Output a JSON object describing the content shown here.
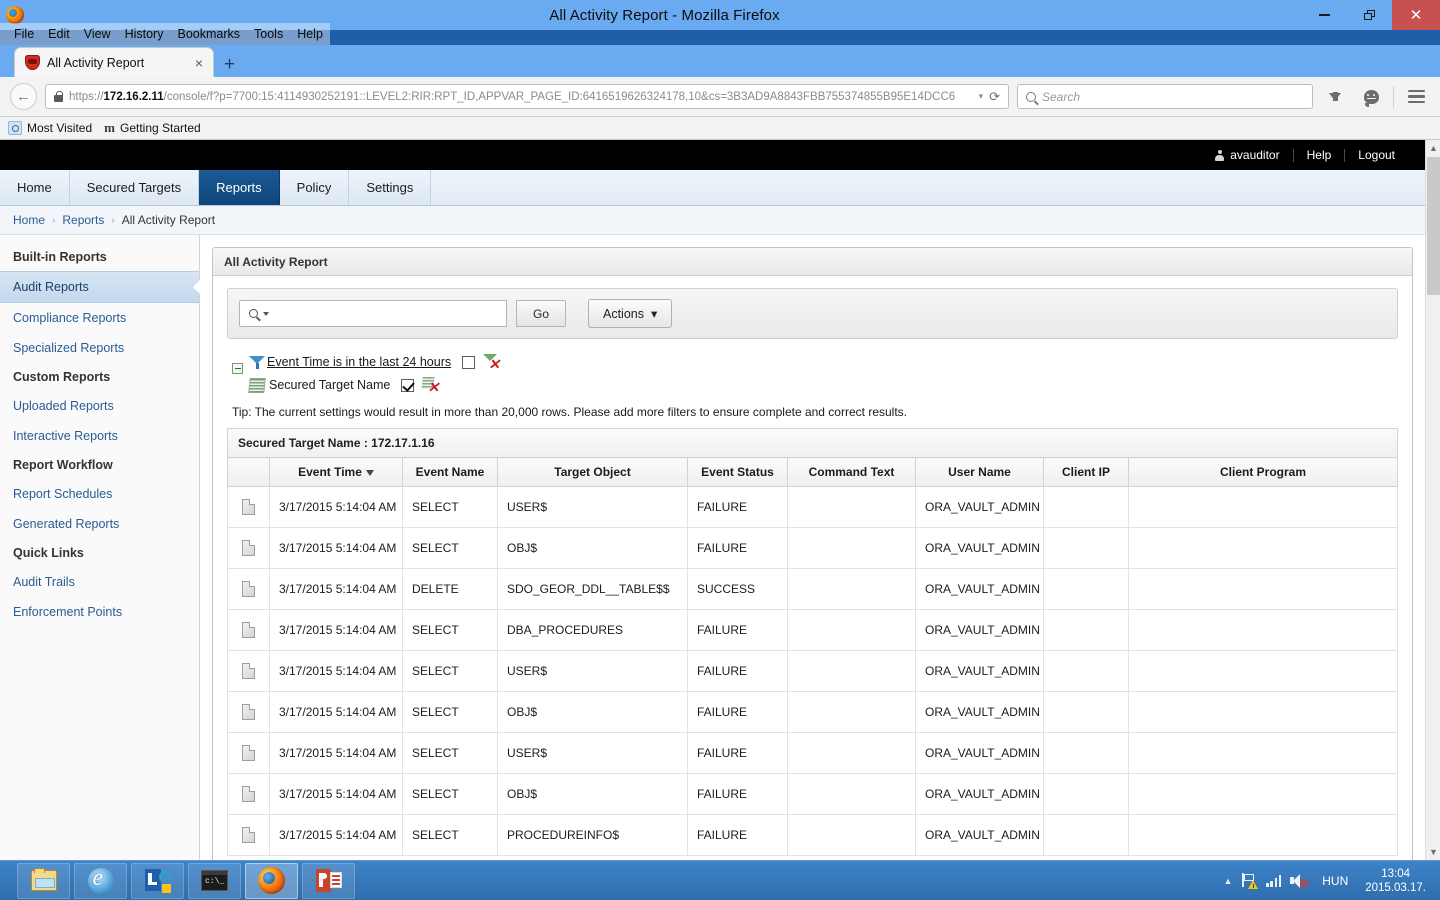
{
  "window": {
    "title": "All Activity Report - Mozilla Firefox",
    "minimize_label": "Minimize",
    "restore_label": "Restore",
    "close_label": "Close"
  },
  "menubar": [
    "File",
    "Edit",
    "View",
    "History",
    "Bookmarks",
    "Tools",
    "Help"
  ],
  "tab": {
    "label": "All Activity Report",
    "close_label": "×",
    "newtab_label": "+"
  },
  "navbar": {
    "back_label": "←",
    "url_scheme": "https://",
    "url_host": "172.16.2.11",
    "url_path": "/console/f?p=7700:15:4114930252191::LEVEL2:RIR:RPT_ID,APPVAR_PAGE_ID:6416519626324178,10&cs=3B3AD9A8843FBB755374855B95E14DCC6",
    "url_full": "https://172.16.2.11/console/f?p=7700:15:4114930252191::LEVEL2:RIR:RPT_ID,APPVAR_PAGE_ID:6416519626324178,10&cs=3B3AD9A8843FBB755374855B95E14DCC6",
    "dropdown_marker": "▾",
    "reload_label": "⟳",
    "search_placeholder": "Search"
  },
  "bookmarks": [
    {
      "label": "Most Visited",
      "icon": "most-visited-icon"
    },
    {
      "label": "Getting Started",
      "icon": "mozilla-m-icon"
    }
  ],
  "topbar": {
    "user": "avauditor",
    "help": "Help",
    "logout": "Logout"
  },
  "apptabs": [
    {
      "label": "Home",
      "active": false
    },
    {
      "label": "Secured Targets",
      "active": false
    },
    {
      "label": "Reports",
      "active": true
    },
    {
      "label": "Policy",
      "active": false
    },
    {
      "label": "Settings",
      "active": false
    }
  ],
  "breadcrumb": {
    "items": [
      "Home",
      "Reports",
      "All Activity Report"
    ],
    "separator": "›"
  },
  "sidebar": {
    "groups": [
      {
        "title": "Built-in Reports",
        "items": [
          {
            "label": "Audit Reports",
            "active": true
          },
          {
            "label": "Compliance Reports",
            "active": false
          },
          {
            "label": "Specialized Reports",
            "active": false
          }
        ]
      },
      {
        "title": "Custom Reports",
        "items": [
          {
            "label": "Uploaded Reports",
            "active": false
          },
          {
            "label": "Interactive Reports",
            "active": false
          }
        ]
      },
      {
        "title": "Report Workflow",
        "items": [
          {
            "label": "Report Schedules",
            "active": false
          },
          {
            "label": "Generated Reports",
            "active": false
          }
        ]
      },
      {
        "title": "Quick Links",
        "items": [
          {
            "label": "Audit Trails",
            "active": false
          },
          {
            "label": "Enforcement Points",
            "active": false
          }
        ]
      }
    ]
  },
  "region": {
    "title": "All Activity Report"
  },
  "search": {
    "value": "",
    "placeholder": "",
    "go_label": "Go",
    "actions_label": "Actions",
    "actions_caret": "▾"
  },
  "filters": {
    "collapse_label": "−",
    "rows": [
      {
        "icon": "filter-funnel-icon",
        "label": "Event Time is in the last 24 hours",
        "checked": false,
        "remove_icon": "remove-filter-icon"
      },
      {
        "icon": "control-break-icon",
        "label": "Secured Target Name",
        "checked": true,
        "remove_icon": "remove-control-break-icon"
      }
    ]
  },
  "tip": "Tip: The current settings would result in more than 20,000 rows. Please add more filters to ensure complete and correct results.",
  "break_header": "Secured Target Name : 172.17.1.16",
  "table": {
    "columns": [
      {
        "key": "icon",
        "label": ""
      },
      {
        "key": "event_time",
        "label": "Event Time",
        "sorted": "desc",
        "sort_marker": "▼"
      },
      {
        "key": "event_name",
        "label": "Event Name"
      },
      {
        "key": "target_object",
        "label": "Target Object"
      },
      {
        "key": "event_status",
        "label": "Event Status"
      },
      {
        "key": "command_text",
        "label": "Command Text"
      },
      {
        "key": "user_name",
        "label": "User Name"
      },
      {
        "key": "client_ip",
        "label": "Client IP"
      },
      {
        "key": "client_program",
        "label": "Client Program"
      }
    ],
    "rows": [
      {
        "event_time": "3/17/2015 5:14:04 AM",
        "event_name": "SELECT",
        "target_object": "USER$",
        "event_status": "FAILURE",
        "command_text": "",
        "user_name": "ORA_VAULT_ADMIN",
        "client_ip": "",
        "client_program": ""
      },
      {
        "event_time": "3/17/2015 5:14:04 AM",
        "event_name": "SELECT",
        "target_object": "OBJ$",
        "event_status": "FAILURE",
        "command_text": "",
        "user_name": "ORA_VAULT_ADMIN",
        "client_ip": "",
        "client_program": ""
      },
      {
        "event_time": "3/17/2015 5:14:04 AM",
        "event_name": "DELETE",
        "target_object": "SDO_GEOR_DDL__TABLE$$",
        "event_status": "SUCCESS",
        "command_text": "",
        "user_name": "ORA_VAULT_ADMIN",
        "client_ip": "",
        "client_program": ""
      },
      {
        "event_time": "3/17/2015 5:14:04 AM",
        "event_name": "SELECT",
        "target_object": "DBA_PROCEDURES",
        "event_status": "FAILURE",
        "command_text": "",
        "user_name": "ORA_VAULT_ADMIN",
        "client_ip": "",
        "client_program": ""
      },
      {
        "event_time": "3/17/2015 5:14:04 AM",
        "event_name": "SELECT",
        "target_object": "USER$",
        "event_status": "FAILURE",
        "command_text": "",
        "user_name": "ORA_VAULT_ADMIN",
        "client_ip": "",
        "client_program": ""
      },
      {
        "event_time": "3/17/2015 5:14:04 AM",
        "event_name": "SELECT",
        "target_object": "OBJ$",
        "event_status": "FAILURE",
        "command_text": "",
        "user_name": "ORA_VAULT_ADMIN",
        "client_ip": "",
        "client_program": ""
      },
      {
        "event_time": "3/17/2015 5:14:04 AM",
        "event_name": "SELECT",
        "target_object": "USER$",
        "event_status": "FAILURE",
        "command_text": "",
        "user_name": "ORA_VAULT_ADMIN",
        "client_ip": "",
        "client_program": ""
      },
      {
        "event_time": "3/17/2015 5:14:04 AM",
        "event_name": "SELECT",
        "target_object": "OBJ$",
        "event_status": "FAILURE",
        "command_text": "",
        "user_name": "ORA_VAULT_ADMIN",
        "client_ip": "",
        "client_program": ""
      },
      {
        "event_time": "3/17/2015 5:14:04 AM",
        "event_name": "SELECT",
        "target_object": "PROCEDUREINFO$",
        "event_status": "FAILURE",
        "command_text": "",
        "user_name": "ORA_VAULT_ADMIN",
        "client_ip": "",
        "client_program": ""
      }
    ]
  },
  "taskbar": {
    "items": [
      {
        "name": "file-explorer",
        "active": false
      },
      {
        "name": "internet-explorer",
        "active": false
      },
      {
        "name": "lync",
        "active": false
      },
      {
        "name": "command-prompt",
        "active": false
      },
      {
        "name": "firefox",
        "active": true
      },
      {
        "name": "powerpoint",
        "active": false
      }
    ],
    "tray": {
      "show_hidden": "▲",
      "language": "HUN",
      "time": "13:04",
      "date": "2015.03.17."
    }
  },
  "colors": {
    "accent_blue": "#1a5a96",
    "titlebar_blue": "#6aaaf0",
    "close_red": "#c75050",
    "taskbar_blue": "#3d83c8",
    "link_blue": "#2a5c93"
  }
}
